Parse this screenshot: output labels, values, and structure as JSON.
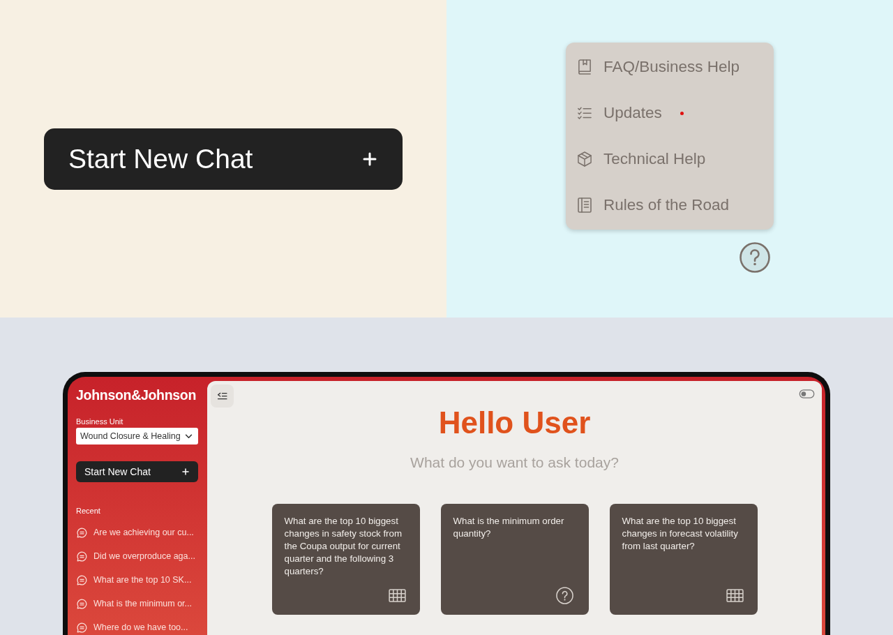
{
  "showcase": {
    "start_chat_button": {
      "label": "Start New Chat"
    }
  },
  "help_menu": {
    "items": [
      {
        "kind": "faq",
        "label": "FAQ/Business Help",
        "new": false
      },
      {
        "kind": "updates",
        "label": "Updates",
        "new": true
      },
      {
        "kind": "technical",
        "label": "Technical Help",
        "new": false
      },
      {
        "kind": "rules",
        "label": "Rules of the Road",
        "new": false
      }
    ]
  },
  "app": {
    "sidebar": {
      "logo": "Johnson&Johnson",
      "business_unit": {
        "label": "Business Unit",
        "value": "Wound Closure & Healing"
      },
      "new_chat_button": {
        "label": "Start New Chat"
      },
      "recent": {
        "heading": "Recent",
        "items": [
          {
            "label": "Are we achieving our cu..."
          },
          {
            "label": "Did we overproduce aga..."
          },
          {
            "label": "What are the top 10 SK..."
          },
          {
            "label": "What is the minimum or..."
          },
          {
            "label": "Where do we have too..."
          }
        ]
      }
    },
    "main": {
      "theme_toggle": {
        "on": false
      },
      "greeting": "Hello User",
      "prompt": "What do you want to ask today?",
      "suggestions": [
        {
          "kind": "table",
          "text": "What are the top 10 biggest changes in safety stock from the Coupa output for current quarter and the following 3 quarters?"
        },
        {
          "kind": "question",
          "text": "What is the minimum order quantity?"
        },
        {
          "kind": "table",
          "text": "What are the top 10 biggest changes in forecast volatility from last quarter?"
        }
      ]
    }
  }
}
